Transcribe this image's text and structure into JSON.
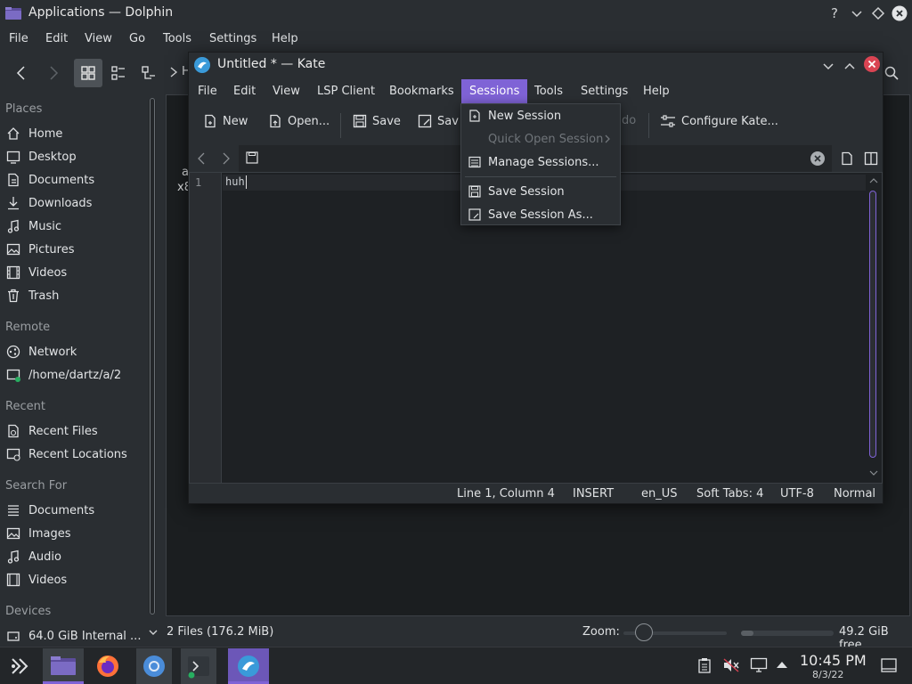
{
  "dolphin": {
    "title": "Applications — Dolphin",
    "menu": [
      "File",
      "Edit",
      "View",
      "Go",
      "Tools",
      "Settings",
      "Help"
    ],
    "breadcrumb_partial": "H",
    "sections": [
      {
        "title": "Places",
        "items": [
          "Home",
          "Desktop",
          "Documents",
          "Downloads",
          "Music",
          "Pictures",
          "Videos",
          "Trash"
        ]
      },
      {
        "title": "Remote",
        "items": [
          "Network",
          "/home/dartz/a/2"
        ]
      },
      {
        "title": "Recent",
        "items": [
          "Recent Files",
          "Recent Locations"
        ]
      },
      {
        "title": "Search For",
        "items": [
          "Documents",
          "Images",
          "Audio",
          "Videos"
        ]
      },
      {
        "title": "Devices",
        "items": [
          "64.0 GiB Internal ..."
        ]
      }
    ],
    "peek_text_1": "a",
    "peek_text_2": "x8",
    "status": "2 Files (176.2 MiB)",
    "zoom_label": "Zoom:",
    "free_space": "49.2 GiB free",
    "zoom_level": 0.2,
    "space_used_fraction": 0.13
  },
  "kate": {
    "title": "Untitled * — Kate",
    "menu": [
      "File",
      "Edit",
      "View",
      "LSP Client",
      "Bookmarks",
      "Sessions",
      "Tools",
      "Settings",
      "Help"
    ],
    "open_menu": "Sessions",
    "toolbar": {
      "new": "New",
      "open": "Open...",
      "save": "Save",
      "save_as_partial": "Sav",
      "redo_partial": "do",
      "configure": "Configure Kate..."
    },
    "line_number": "1",
    "text": "huh",
    "status": {
      "position": "Line 1, Column 4",
      "mode": "INSERT",
      "lang": "en_US",
      "tabs": "Soft Tabs: 4",
      "encoding": "UTF-8",
      "input": "Normal"
    }
  },
  "sessions_menu": {
    "new_session": "New Session",
    "quick_open": "Quick Open Session",
    "manage": "Manage Sessions...",
    "save": "Save Session",
    "save_as": "Save Session As..."
  },
  "taskbar": {
    "time": "10:45 PM",
    "date": "8/3/22"
  },
  "colors": {
    "accent": "#7f63d6",
    "window_bg": "#2a2e32",
    "view_bg": "#1b1e20",
    "close_red": "#da4453"
  }
}
